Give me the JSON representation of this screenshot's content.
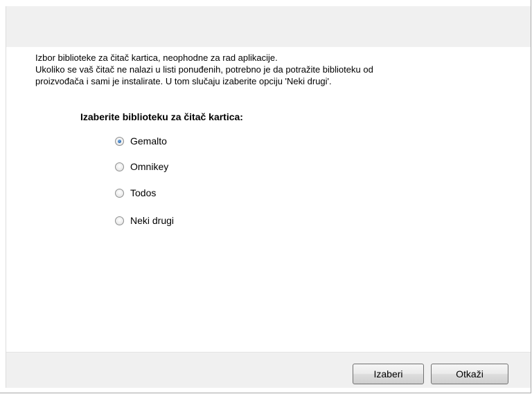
{
  "dialog": {
    "intro_lines": [
      "Izbor biblioteke za čitač kartica, neophodne za rad aplikacije.",
      "Ukoliko se vaš čitač ne nalazi u listi ponuđenih, potrebno je da potražite biblioteku od",
      "proizvođača i sami je instalirate. U tom slučaju izaberite opciju 'Neki drugi'."
    ],
    "group_title": "Izaberite biblioteku za čitač kartica:",
    "options": [
      {
        "label": "Gemalto",
        "selected": true
      },
      {
        "label": "Omnikey",
        "selected": false
      },
      {
        "label": "Todos",
        "selected": false
      },
      {
        "label": "Neki drugi",
        "selected": false
      }
    ]
  },
  "footer": {
    "select_label": "Izaberi",
    "cancel_label": "Otkaži"
  },
  "colors": {
    "panel_bg": "#f0f0f0",
    "content_bg": "#ffffff",
    "radio_dot": "#1f5fa8"
  }
}
